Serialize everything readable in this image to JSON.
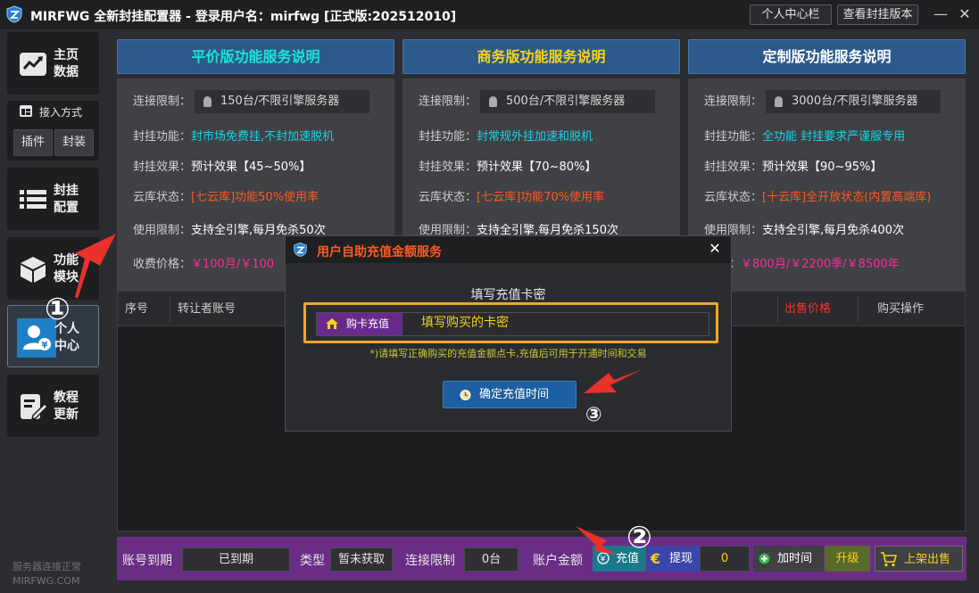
{
  "window": {
    "title": "MIRFWG 全新封挂配置器 - 登录用户名：mirfwg  [正式版:202512010]",
    "btn_personal": "个人中心栏",
    "btn_version": "查看封挂版本",
    "minimize": "—",
    "close": "✕"
  },
  "sidebar": {
    "home": "主页\n数据",
    "access_title": "接入方式",
    "access_plugin": "插件",
    "access_pack": "封装",
    "config": "封挂\n配置",
    "modules": "功能\n模块",
    "personal": "个人\n中心",
    "tutorial": "教程\n更新",
    "status": "服务器连接正常",
    "domain": "MIRFWG.COM"
  },
  "plans": [
    {
      "title": "平价版功能服务说明",
      "title_color": "#19e6d2",
      "limit_label": "连接限制：",
      "limit": "150台/不限引擎服务器",
      "func_label": "封挂功能：",
      "func": "封市场免费挂,不封加速脱机",
      "effect_label": "封挂效果：",
      "effect": "预计效果【45~50%】",
      "cloud_label": "云库状态：",
      "cloud": "[七云库]功能50%使用率",
      "usage_label": "使用限制：",
      "usage": "支持全引擎,每月免杀50次",
      "price_label": "收费价格：",
      "price": "￥100月/￥100"
    },
    {
      "title": "商务版功能服务说明",
      "title_color": "#f7d21a",
      "limit_label": "连接限制：",
      "limit": "500台/不限引擎服务器",
      "func_label": "封挂功能：",
      "func": "封常规外挂加速和脱机",
      "effect_label": "封挂效果：",
      "effect": "预计效果【70~80%】",
      "cloud_label": "云库状态：",
      "cloud": "[七云库]功能70%使用率",
      "usage_label": "使用限制：",
      "usage": "支持全引擎,每月免杀150次",
      "price_label": "",
      "price": ""
    },
    {
      "title": "定制版功能服务说明",
      "title_color": "#ffffff",
      "limit_label": "连接限制：",
      "limit": "3000台/不限引擎服务器",
      "func_label": "封挂功能：",
      "func": "全功能 封挂要求严谨服专用",
      "effect_label": "封挂效果：",
      "effect": "预计效果【90~95%】",
      "cloud_label": "云库状态：",
      "cloud": "[十云库]全开放状态(内置高端库)",
      "usage_label": "使用限制：",
      "usage": "支持全引擎,每月免杀400次",
      "price_label": "价格：",
      "price": "￥800月/￥2200季/￥8500年"
    }
  ],
  "table": {
    "col_index": "序号",
    "col_seller": "转让者账号",
    "col_price": "出售价格",
    "col_action": "购买操作"
  },
  "modal": {
    "title": "用户自助充值金额服务",
    "close": "✕",
    "label": "填写充值卡密",
    "tag": "购卡充值",
    "placeholder": "填写购买的卡密",
    "note": "*)请填写正确购买的充值金额点卡,充值后可用于开通时间和交易",
    "confirm": "确定充值时间"
  },
  "bottom": {
    "expire_label": "账号到期",
    "expire_value": "已到期",
    "type_label": "类型",
    "type_value": "暂未获取",
    "limit_label": "连接限制",
    "limit_value": "0台",
    "balance_label": "账户金额",
    "recharge": "充值",
    "withdraw": "提现",
    "balance_value": "0",
    "add_time": "加时间",
    "upgrade": "升级",
    "list_sale": "上架出售"
  },
  "annotations": {
    "step1": "①",
    "step2": "②",
    "step3": "③"
  },
  "colors": {
    "accent_blue": "#2d5a8c",
    "purple": "#6a2d85",
    "highlight_orange": "#f0a72a",
    "arrow_red": "#e8322b"
  }
}
